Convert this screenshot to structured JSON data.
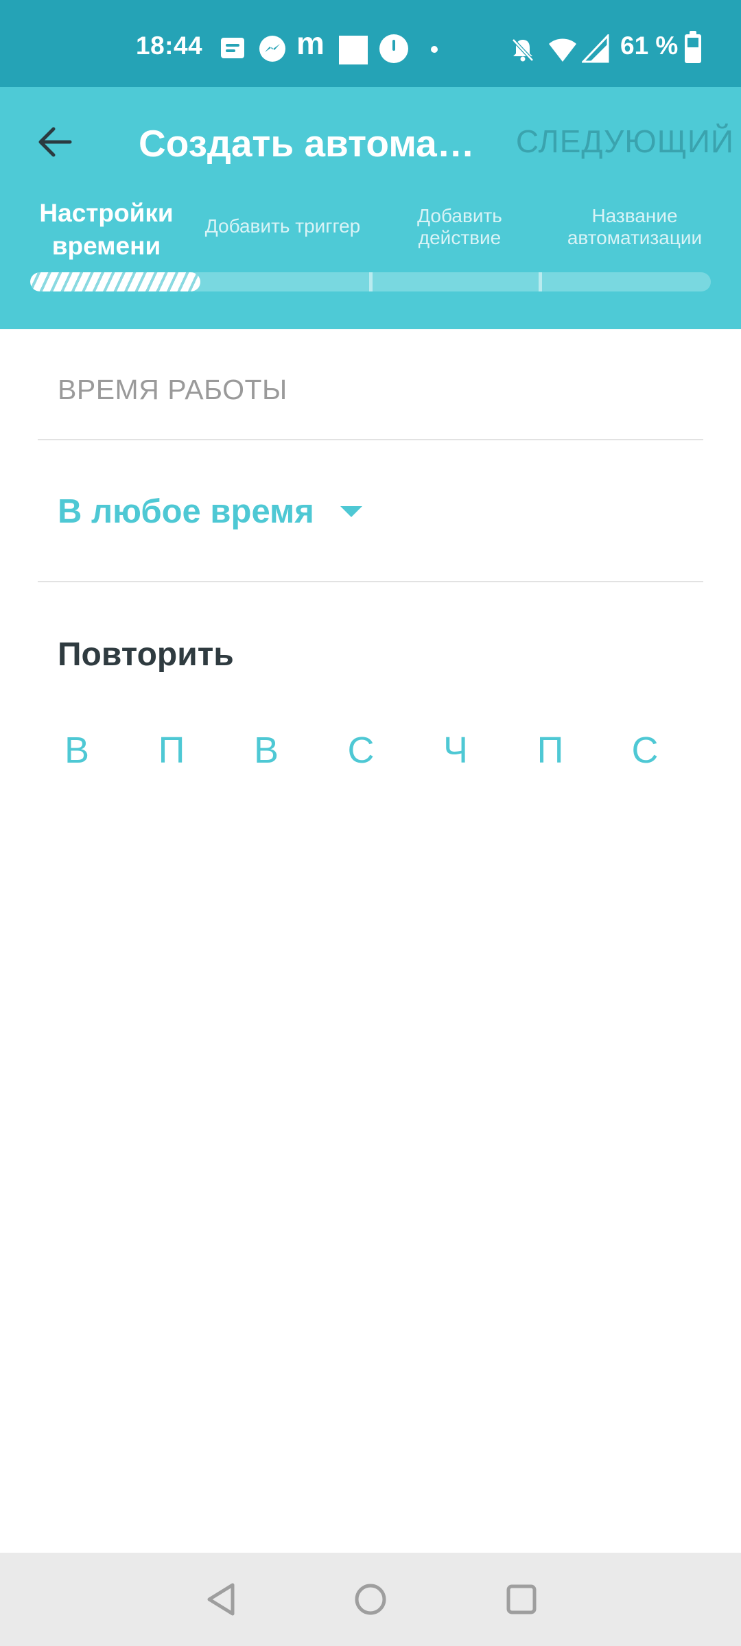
{
  "status_bar": {
    "time": "18:44",
    "battery": "61 %",
    "icons": [
      "message-icon",
      "messenger-icon",
      "m-app-icon",
      "square-icon",
      "clock-icon",
      "dot-icon",
      "bell-muted-icon",
      "wifi-icon",
      "signal-icon",
      "battery-icon"
    ],
    "background": "#25a3b6"
  },
  "header": {
    "title": "Создать автоматизацию",
    "next_label": "СЛЕДУЮЩИЙ",
    "background": "#4ecad6",
    "steps": [
      {
        "label": "Настройки времени"
      },
      {
        "label": "Добавить триггер"
      },
      {
        "label": "Добавить действие"
      },
      {
        "label": "Название автоматизации"
      }
    ],
    "progress": 0.25,
    "current_step": 1
  },
  "content": {
    "section_label": "ВРЕМЯ РАБОТЫ",
    "time_select": "В любое время",
    "repeat_title": "Повторить",
    "days": [
      "В",
      "П",
      "В",
      "С",
      "Ч",
      "П",
      "С"
    ],
    "accent": "#4ec8d4"
  },
  "nav_bar": {
    "buttons": [
      "back-triangle-icon",
      "home-circle-icon",
      "recents-square-icon"
    ]
  }
}
